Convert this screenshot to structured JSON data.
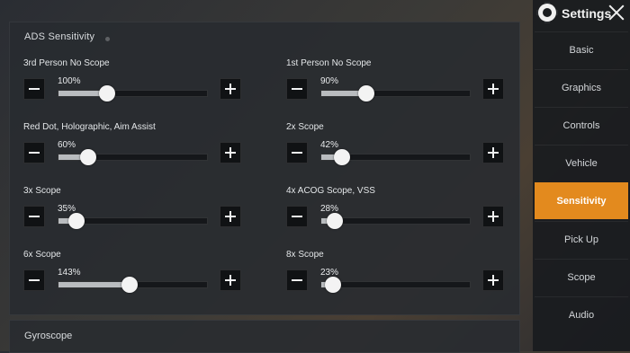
{
  "header": {
    "title": "Settings"
  },
  "sidebar": {
    "items": [
      {
        "label": "Basic",
        "active": false
      },
      {
        "label": "Graphics",
        "active": false
      },
      {
        "label": "Controls",
        "active": false
      },
      {
        "label": "Vehicle",
        "active": false
      },
      {
        "label": "Sensitivity",
        "active": true
      },
      {
        "label": "Pick Up",
        "active": false
      },
      {
        "label": "Scope",
        "active": false
      },
      {
        "label": "Audio",
        "active": false
      }
    ]
  },
  "ads": {
    "title": "ADS Sensitivity",
    "settings": [
      {
        "label": "3rd Person No Scope",
        "value": "100%",
        "level": 0.33
      },
      {
        "label": "1st Person No Scope",
        "value": "90%",
        "level": 0.3
      },
      {
        "label": "Red Dot, Holographic, Aim Assist",
        "value": "60%",
        "level": 0.2
      },
      {
        "label": "2x Scope",
        "value": "42%",
        "level": 0.14
      },
      {
        "label": "3x Scope",
        "value": "35%",
        "level": 0.12
      },
      {
        "label": "4x ACOG Scope, VSS",
        "value": "28%",
        "level": 0.09
      },
      {
        "label": "6x Scope",
        "value": "143%",
        "level": 0.48
      },
      {
        "label": "8x Scope",
        "value": "23%",
        "level": 0.08
      }
    ]
  },
  "gyroscope": {
    "title": "Gyroscope"
  },
  "colors": {
    "accent": "#e38a1e"
  }
}
